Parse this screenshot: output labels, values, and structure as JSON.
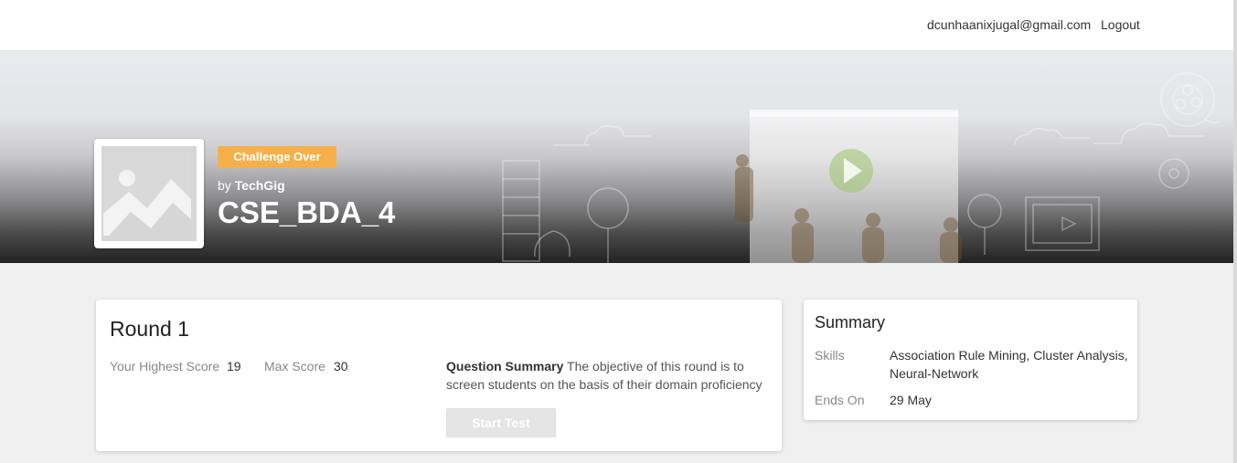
{
  "header": {
    "user_email": "dcunhaanixjugal@gmail.com",
    "logout_label": "Logout"
  },
  "hero": {
    "status_badge": "Challenge Over",
    "by_prefix": "by",
    "organizer": "TechGig",
    "challenge_title": "CSE_BDA_4",
    "logo_icon": "image-placeholder-icon"
  },
  "round": {
    "title": "Round 1",
    "highest_score_label": "Your Highest Score",
    "highest_score_value": "19",
    "max_score_label": "Max Score",
    "max_score_value": "30",
    "question_summary_label": "Question Summary",
    "question_summary_text": "The objective of this round is to screen students on the basis of their domain proficiency",
    "start_button_label": "Start Test"
  },
  "summary": {
    "title": "Summary",
    "skills_label": "Skills",
    "skills_value": "Association Rule Mining, Cluster Analysis, Neural-Network",
    "ends_on_label": "Ends On",
    "ends_on_value": "29 May"
  },
  "colors": {
    "badge": "#f5b04b",
    "page_background": "#f0f0f0"
  }
}
